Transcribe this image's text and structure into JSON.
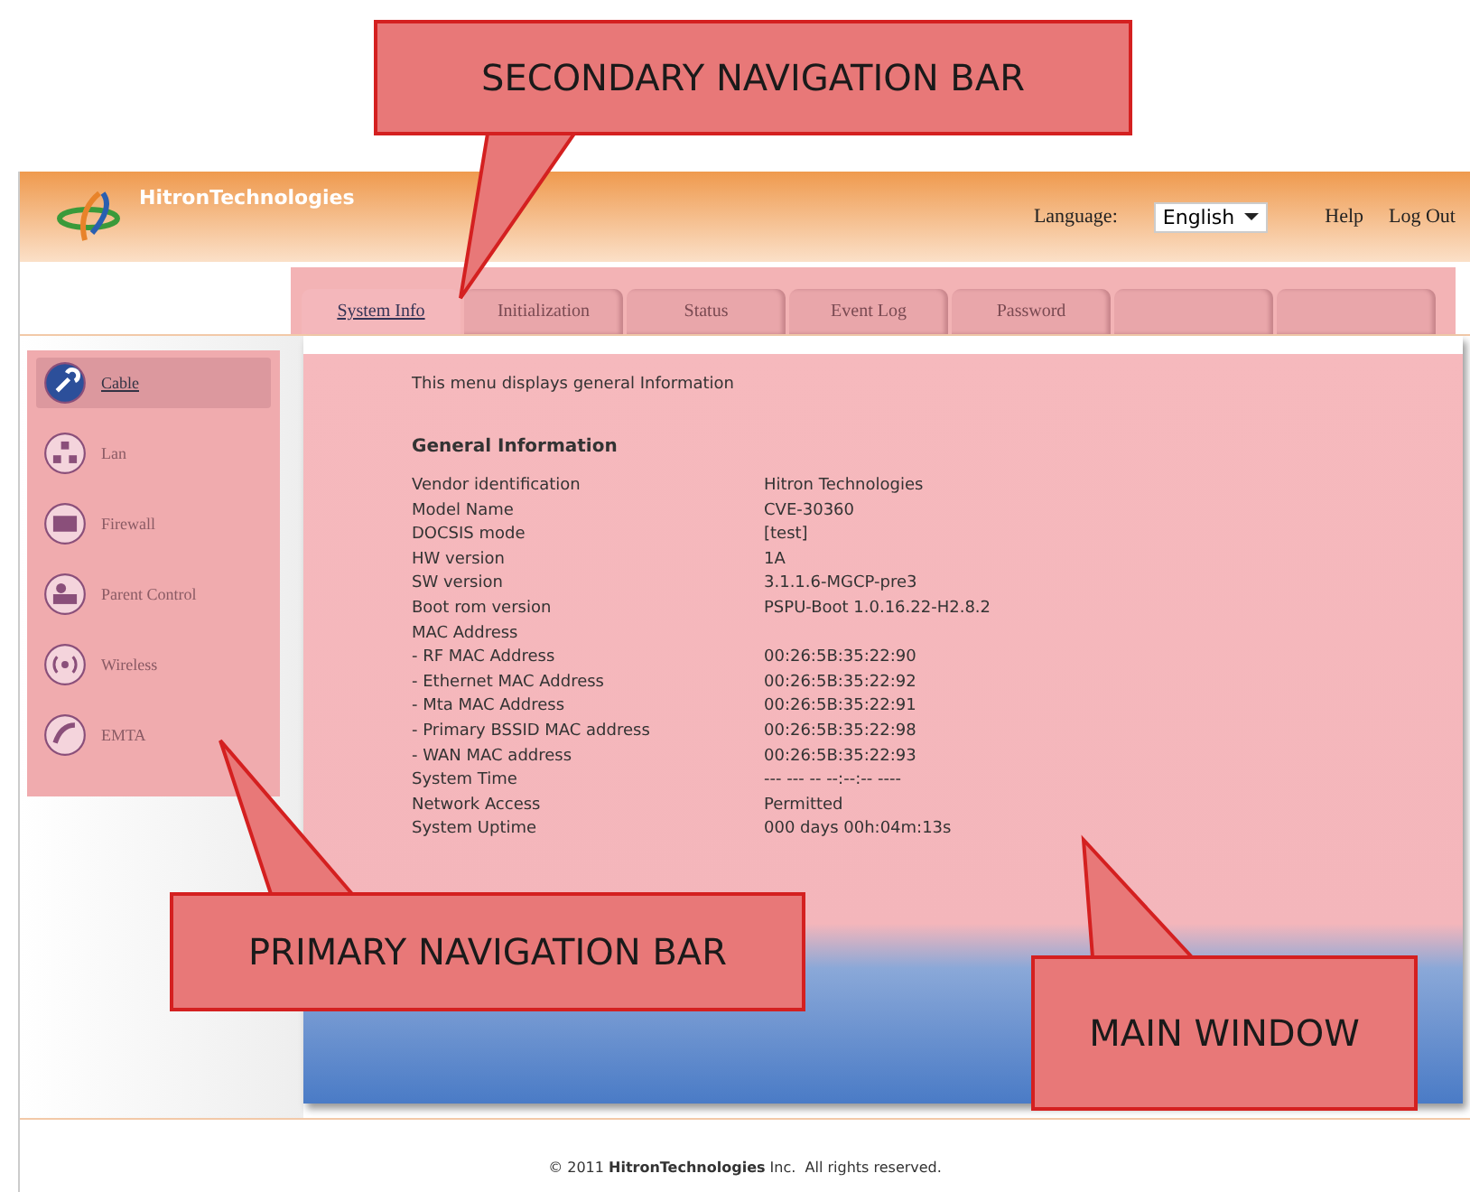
{
  "header": {
    "brand": "HitronTechnologies",
    "language_label": "Language:",
    "language": "English",
    "links": [
      "Help",
      "Log Out"
    ]
  },
  "tabs": [
    {
      "label": "System Info",
      "selected": true
    },
    {
      "label": "Initialization",
      "selected": false
    },
    {
      "label": "Status",
      "selected": false
    },
    {
      "label": "Event Log",
      "selected": false
    },
    {
      "label": "Password",
      "selected": false
    },
    {
      "selected": false
    },
    {
      "selected": false
    }
  ],
  "sidebar": {
    "items": [
      {
        "label": "Cable",
        "selected": true
      },
      {
        "label": "Lan",
        "selected": false
      },
      {
        "label": "Firewall",
        "selected": false
      },
      {
        "label": "Parent Control",
        "selected": false
      },
      {
        "label": "Wireless",
        "selected": false
      },
      {
        "label": "EMTA",
        "selected": false
      }
    ]
  },
  "main": {
    "intro": "This menu displays general Information",
    "section_title": "General Information",
    "rows": [
      {
        "label": "Vendor identification",
        "value": "Hitron Technologies"
      },
      {
        "label": "Model Name",
        "value": "CVE-30360"
      },
      {
        "label": "DOCSIS mode",
        "value": "[test]"
      },
      {
        "label": "HW version",
        "value": "1A"
      },
      {
        "label": "SW version",
        "value": "3.1.1.6-MGCP-pre3"
      },
      {
        "label": "Boot rom version",
        "value": "PSPU-Boot 1.0.16.22-H2.8.2"
      },
      {
        "label": "MAC Address"
      },
      {
        "label": "- RF MAC Address",
        "value": "00:26:5B:35:22:90"
      },
      {
        "label": "- Ethernet MAC Address",
        "value": "00:26:5B:35:22:92"
      },
      {
        "label": "- Mta MAC Address",
        "value": "00:26:5B:35:22:91"
      },
      {
        "label": "- Primary BSSID MAC address",
        "value": "00:26:5B:35:22:98"
      },
      {
        "label": "- WAN MAC address",
        "value": "00:26:5B:35:22:93"
      },
      {
        "label": "System Time",
        "value": "--- --- -- --:--:-- ----"
      },
      {
        "label": "Network Access",
        "value": "Permitted"
      },
      {
        "label": "System Uptime",
        "value": "000 days 00h:04m:13s"
      }
    ]
  },
  "footer": {
    "text": "© 2011 **HitronTechnologies** Inc.  All rights reserved."
  },
  "annotations": [
    {
      "text": "SECONDARY NAVIGATION BAR"
    },
    {
      "text": "PRIMARY NAVIGATION BAR"
    },
    {
      "text": "MAIN WINDOW"
    }
  ]
}
